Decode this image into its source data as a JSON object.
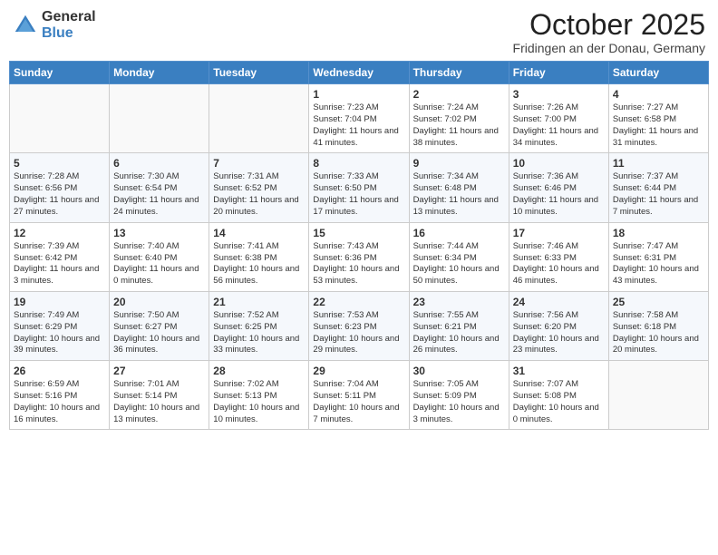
{
  "header": {
    "logo_general": "General",
    "logo_blue": "Blue",
    "month_title": "October 2025",
    "location": "Fridingen an der Donau, Germany"
  },
  "weekdays": [
    "Sunday",
    "Monday",
    "Tuesday",
    "Wednesday",
    "Thursday",
    "Friday",
    "Saturday"
  ],
  "weeks": [
    [
      {
        "day": "",
        "info": ""
      },
      {
        "day": "",
        "info": ""
      },
      {
        "day": "",
        "info": ""
      },
      {
        "day": "1",
        "info": "Sunrise: 7:23 AM\nSunset: 7:04 PM\nDaylight: 11 hours and 41 minutes."
      },
      {
        "day": "2",
        "info": "Sunrise: 7:24 AM\nSunset: 7:02 PM\nDaylight: 11 hours and 38 minutes."
      },
      {
        "day": "3",
        "info": "Sunrise: 7:26 AM\nSunset: 7:00 PM\nDaylight: 11 hours and 34 minutes."
      },
      {
        "day": "4",
        "info": "Sunrise: 7:27 AM\nSunset: 6:58 PM\nDaylight: 11 hours and 31 minutes."
      }
    ],
    [
      {
        "day": "5",
        "info": "Sunrise: 7:28 AM\nSunset: 6:56 PM\nDaylight: 11 hours and 27 minutes."
      },
      {
        "day": "6",
        "info": "Sunrise: 7:30 AM\nSunset: 6:54 PM\nDaylight: 11 hours and 24 minutes."
      },
      {
        "day": "7",
        "info": "Sunrise: 7:31 AM\nSunset: 6:52 PM\nDaylight: 11 hours and 20 minutes."
      },
      {
        "day": "8",
        "info": "Sunrise: 7:33 AM\nSunset: 6:50 PM\nDaylight: 11 hours and 17 minutes."
      },
      {
        "day": "9",
        "info": "Sunrise: 7:34 AM\nSunset: 6:48 PM\nDaylight: 11 hours and 13 minutes."
      },
      {
        "day": "10",
        "info": "Sunrise: 7:36 AM\nSunset: 6:46 PM\nDaylight: 11 hours and 10 minutes."
      },
      {
        "day": "11",
        "info": "Sunrise: 7:37 AM\nSunset: 6:44 PM\nDaylight: 11 hours and 7 minutes."
      }
    ],
    [
      {
        "day": "12",
        "info": "Sunrise: 7:39 AM\nSunset: 6:42 PM\nDaylight: 11 hours and 3 minutes."
      },
      {
        "day": "13",
        "info": "Sunrise: 7:40 AM\nSunset: 6:40 PM\nDaylight: 11 hours and 0 minutes."
      },
      {
        "day": "14",
        "info": "Sunrise: 7:41 AM\nSunset: 6:38 PM\nDaylight: 10 hours and 56 minutes."
      },
      {
        "day": "15",
        "info": "Sunrise: 7:43 AM\nSunset: 6:36 PM\nDaylight: 10 hours and 53 minutes."
      },
      {
        "day": "16",
        "info": "Sunrise: 7:44 AM\nSunset: 6:34 PM\nDaylight: 10 hours and 50 minutes."
      },
      {
        "day": "17",
        "info": "Sunrise: 7:46 AM\nSunset: 6:33 PM\nDaylight: 10 hours and 46 minutes."
      },
      {
        "day": "18",
        "info": "Sunrise: 7:47 AM\nSunset: 6:31 PM\nDaylight: 10 hours and 43 minutes."
      }
    ],
    [
      {
        "day": "19",
        "info": "Sunrise: 7:49 AM\nSunset: 6:29 PM\nDaylight: 10 hours and 39 minutes."
      },
      {
        "day": "20",
        "info": "Sunrise: 7:50 AM\nSunset: 6:27 PM\nDaylight: 10 hours and 36 minutes."
      },
      {
        "day": "21",
        "info": "Sunrise: 7:52 AM\nSunset: 6:25 PM\nDaylight: 10 hours and 33 minutes."
      },
      {
        "day": "22",
        "info": "Sunrise: 7:53 AM\nSunset: 6:23 PM\nDaylight: 10 hours and 29 minutes."
      },
      {
        "day": "23",
        "info": "Sunrise: 7:55 AM\nSunset: 6:21 PM\nDaylight: 10 hours and 26 minutes."
      },
      {
        "day": "24",
        "info": "Sunrise: 7:56 AM\nSunset: 6:20 PM\nDaylight: 10 hours and 23 minutes."
      },
      {
        "day": "25",
        "info": "Sunrise: 7:58 AM\nSunset: 6:18 PM\nDaylight: 10 hours and 20 minutes."
      }
    ],
    [
      {
        "day": "26",
        "info": "Sunrise: 6:59 AM\nSunset: 5:16 PM\nDaylight: 10 hours and 16 minutes."
      },
      {
        "day": "27",
        "info": "Sunrise: 7:01 AM\nSunset: 5:14 PM\nDaylight: 10 hours and 13 minutes."
      },
      {
        "day": "28",
        "info": "Sunrise: 7:02 AM\nSunset: 5:13 PM\nDaylight: 10 hours and 10 minutes."
      },
      {
        "day": "29",
        "info": "Sunrise: 7:04 AM\nSunset: 5:11 PM\nDaylight: 10 hours and 7 minutes."
      },
      {
        "day": "30",
        "info": "Sunrise: 7:05 AM\nSunset: 5:09 PM\nDaylight: 10 hours and 3 minutes."
      },
      {
        "day": "31",
        "info": "Sunrise: 7:07 AM\nSunset: 5:08 PM\nDaylight: 10 hours and 0 minutes."
      },
      {
        "day": "",
        "info": ""
      }
    ]
  ]
}
